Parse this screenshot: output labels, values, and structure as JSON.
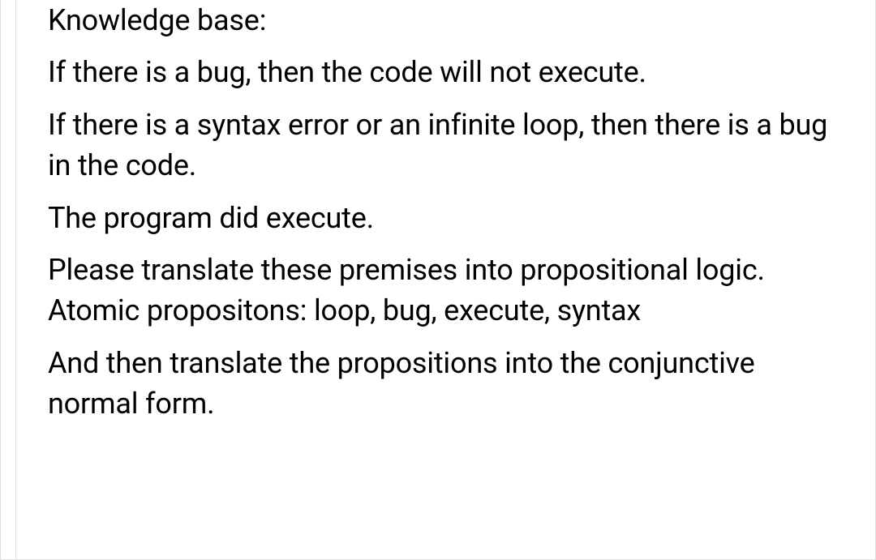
{
  "content": {
    "lines": [
      "Knowledge base:",
      "If there is a bug, then the code will not execute.",
      "If there is a syntax error or an infinite loop, then there is a bug in the code.",
      "The program did execute.",
      "Please translate these premises into propositional logic. Atomic propositons: loop, bug, execute, syntax",
      "And then translate the propositions into the conjunctive normal form."
    ]
  }
}
